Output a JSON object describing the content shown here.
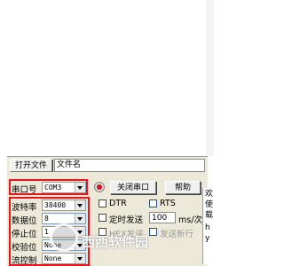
{
  "file_bar": {
    "open_file_label": "打开文件",
    "file_name_value": "文件名"
  },
  "port": {
    "label": "串口号",
    "value": "COM3",
    "close_button": "关闭串口",
    "help_button": "帮助"
  },
  "settings": {
    "baud_label": "波特率",
    "baud_value": "38400",
    "data_bits_label": "数据位",
    "data_bits_value": "8",
    "stop_bits_label": "停止位",
    "stop_bits_value": "1",
    "parity_label": "校验位",
    "parity_value": "None",
    "flow_label": "流控制",
    "flow_value": "None"
  },
  "options": {
    "dtr_label": "DTR",
    "rts_label": "RTS",
    "timed_send_label": "定时发送",
    "interval_value": "100",
    "interval_unit": "ms/次",
    "hex_send_label": "HEX发送",
    "send_newline_label": "发送新行"
  },
  "right_column": {
    "lines": [
      "欢",
      "使",
      "载",
      "h",
      "y"
    ]
  },
  "watermark": {
    "text": "西西软件园"
  },
  "colors": {
    "highlight_red": "#e8141a",
    "panel_bg": "#ece9d8"
  }
}
